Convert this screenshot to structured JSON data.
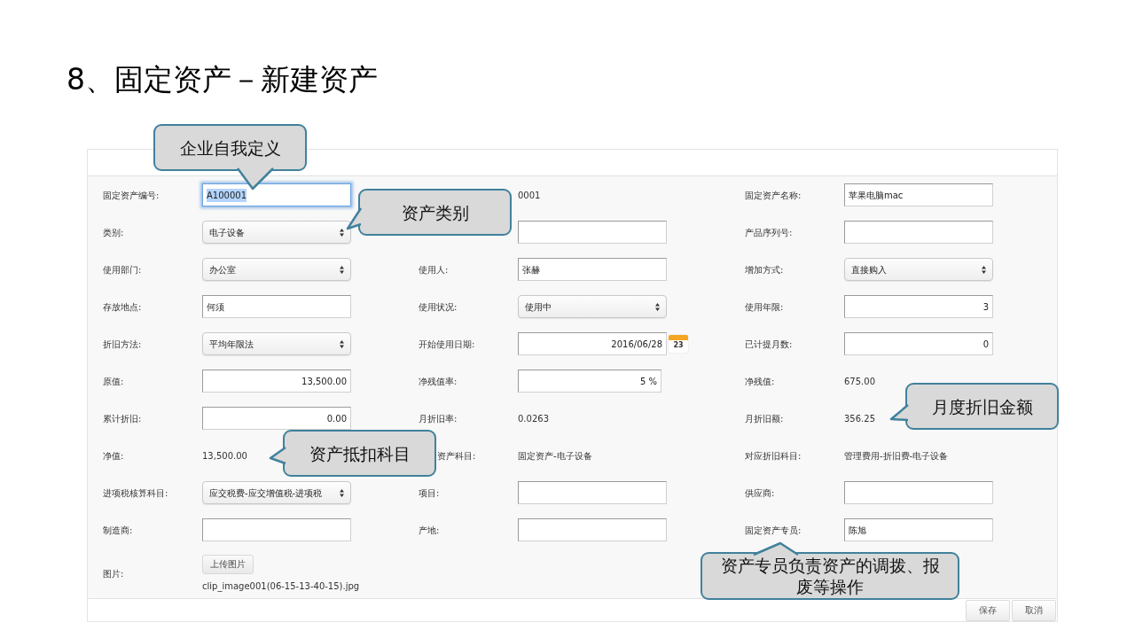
{
  "title": "8、固定资产－新建资产",
  "form": {
    "rows": [
      [
        {
          "label": "固定资产编号:",
          "kind": "text",
          "value": "A100001",
          "focused": true
        },
        {
          "kind": "static",
          "value": "0001"
        },
        {
          "label": "固定资产名称:",
          "kind": "text",
          "value": "苹果电脑mac",
          "focused": false
        }
      ],
      [
        {
          "label": "类别:",
          "kind": "select",
          "value": "电子设备"
        },
        {
          "kind": "text",
          "focused": false
        },
        {
          "label": "产品序列号:",
          "kind": "text",
          "focused": false
        }
      ],
      [
        {
          "label": "使用部门:",
          "kind": "select",
          "value": "办公室"
        },
        {
          "label": "使用人:",
          "kind": "text",
          "value": "张赫",
          "focused": false
        },
        {
          "label": "增加方式:",
          "kind": "select",
          "value": "直接购入"
        }
      ],
      [
        {
          "label": "存放地点:",
          "kind": "text",
          "value": "何须",
          "focused": false
        },
        {
          "label": "使用状况:",
          "kind": "select",
          "value": "使用中"
        },
        {
          "label": "使用年限:",
          "kind": "number",
          "value": "3",
          "focused": false
        }
      ],
      [
        {
          "label": "折旧方法:",
          "kind": "select",
          "value": "平均年限法"
        },
        {
          "label": "开始使用日期:",
          "kind": "date",
          "value": "2016/06/28",
          "day": "23",
          "focused": false
        },
        {
          "label": "已计提月数:",
          "kind": "number",
          "value": "0",
          "focused": false
        }
      ],
      [
        {
          "label": "原值:",
          "kind": "number",
          "value": "13,500.00",
          "focused": false
        },
        {
          "label": "净残值率:",
          "kind": "percent",
          "value": "5 %",
          "focused": false
        },
        {
          "label": "净残值:",
          "kind": "static",
          "value": "675.00"
        }
      ],
      [
        {
          "label": "累计折旧:",
          "kind": "number",
          "value": "0.00",
          "focused": false
        },
        {
          "label": "月折旧率:",
          "kind": "static",
          "value": "0.0263"
        },
        {
          "label": "月折旧额:",
          "kind": "static",
          "value": "356.25"
        }
      ],
      [
        {
          "label": "净值:",
          "kind": "static",
          "value": "13,500.00"
        },
        {
          "label": "资产科目:",
          "kind": "static",
          "value": "固定资产-电子设备",
          "clipped": true
        },
        {
          "label": "对应折旧科目:",
          "kind": "static",
          "value": "管理费用-折旧费-电子设备"
        }
      ],
      [
        {
          "label": "进项税核算科目:",
          "kind": "select",
          "value": "应交税费-应交增值税-进项税"
        },
        {
          "label": "项目:",
          "kind": "text",
          "focused": false
        },
        {
          "label": "供应商:",
          "kind": "text",
          "focused": false
        }
      ],
      [
        {
          "label": "制造商:",
          "kind": "text",
          "focused": false
        },
        {
          "label": "产地:",
          "kind": "text",
          "focused": false
        },
        {
          "label": "固定资产专员:",
          "kind": "text",
          "value": "陈旭",
          "focused": false
        }
      ]
    ],
    "image": {
      "label": "图片:",
      "button": "上传图片",
      "filename": "clip_image001(06-15-13-40-15).jpg"
    },
    "buttons": [
      "保存",
      "取消"
    ]
  },
  "callouts": [
    {
      "text": "企业自我定义"
    },
    {
      "text": "资产类别"
    },
    {
      "text": "月度折旧金额"
    },
    {
      "text": "资产抵扣科目"
    },
    {
      "text": "资产专员负责资产的调拨、报废等操作"
    }
  ]
}
